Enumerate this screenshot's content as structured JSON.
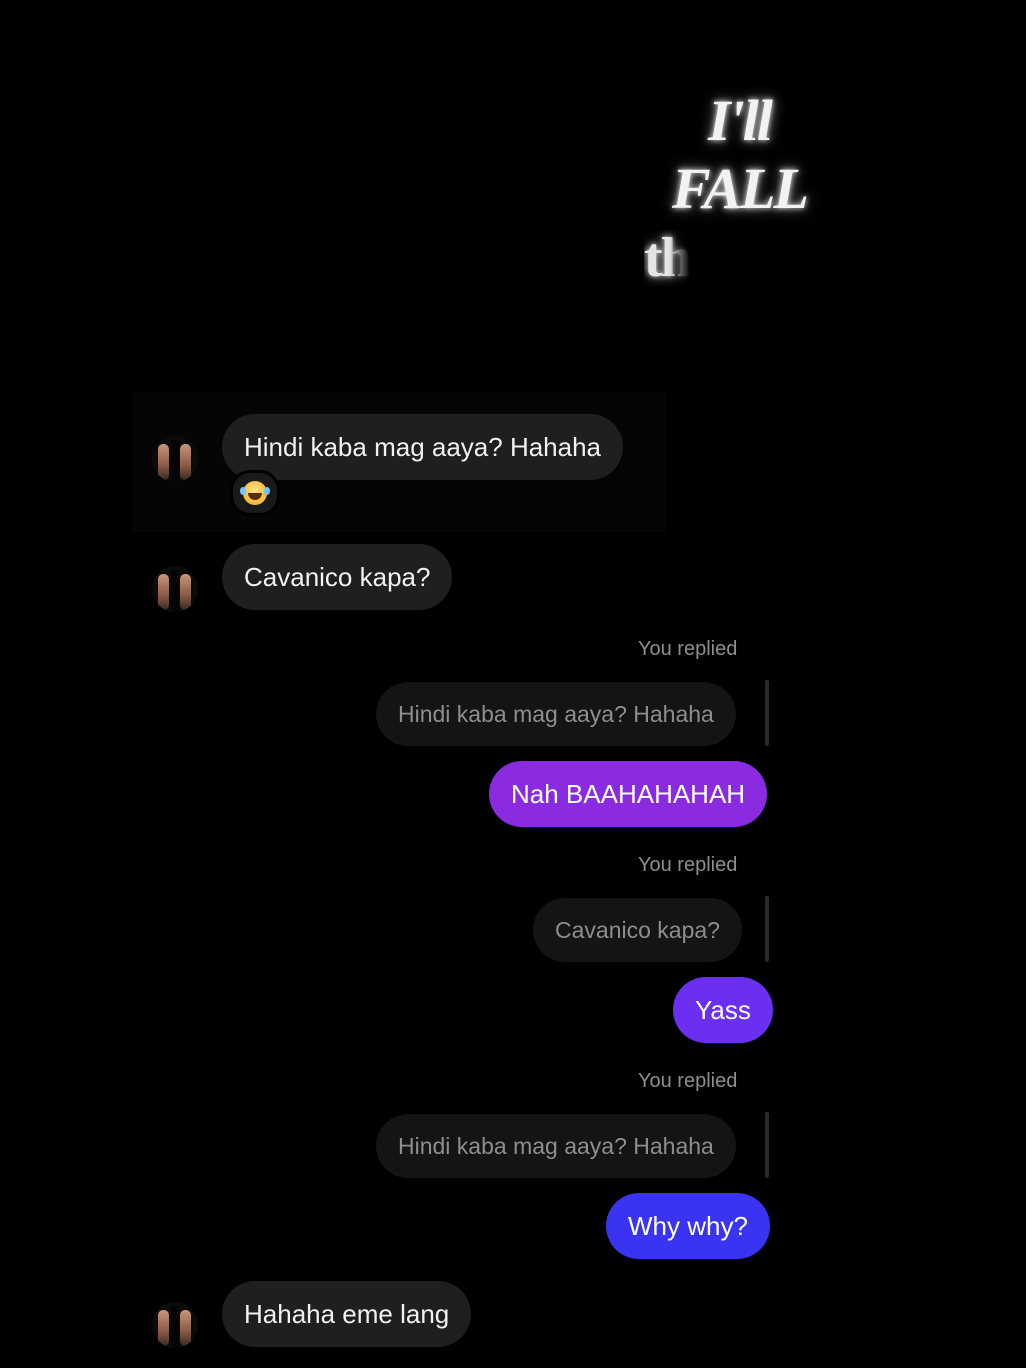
{
  "overlay": {
    "line1": "I'll",
    "line2": "FALL",
    "line3": "th"
  },
  "messages": {
    "m1": {
      "text": "Hindi kaba mag aaya? Hahaha",
      "reaction": "joy-emoji"
    },
    "m2": {
      "text": "Cavanico kapa?"
    },
    "r1": {
      "label": "You replied",
      "quoted": "Hindi kaba mag aaya? Hahaha",
      "text": "Nah BAAHAHAHAH"
    },
    "r2": {
      "label": "You replied",
      "quoted": "Cavanico kapa?",
      "text": "Yass"
    },
    "r3": {
      "label": "You replied",
      "quoted": "Hindi kaba mag aaya? Hahaha",
      "text": "Why why?"
    },
    "m3": {
      "text": "Hahaha eme lang"
    }
  },
  "colors": {
    "background": "#000000",
    "incoming_bubble": "#1f1f1f",
    "quoted_bubble": "#141414",
    "outgoing_1": "#8a2be2",
    "outgoing_2": "#6a2ff0",
    "outgoing_3": "#3a34f2"
  }
}
